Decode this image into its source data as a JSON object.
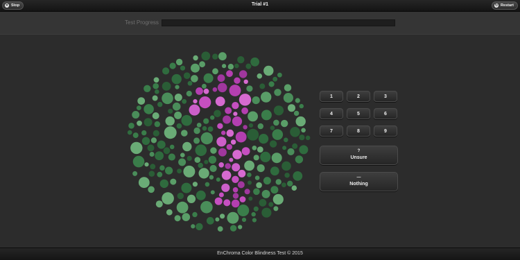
{
  "header": {
    "title": "Trial #1",
    "stop_label": "Stop",
    "restart_label": "Restart"
  },
  "progress": {
    "label": "Test Progress",
    "value": 0
  },
  "plate": {
    "shown_digit": "1",
    "background_colors": [
      "#2f6b3e",
      "#3a7d4a",
      "#4a8d5a",
      "#5a9e68",
      "#2a5d36",
      "#6aab76"
    ],
    "figure_colors": [
      "#b43fb0",
      "#c54fc0",
      "#d66ad0",
      "#a0379e",
      "#cc5fc9"
    ]
  },
  "keypad": {
    "buttons": [
      {
        "label": "1"
      },
      {
        "label": "2"
      },
      {
        "label": "3"
      },
      {
        "label": "4"
      },
      {
        "label": "5"
      },
      {
        "label": "6"
      },
      {
        "label": "7"
      },
      {
        "label": "8"
      },
      {
        "label": "9"
      }
    ],
    "unsure": {
      "symbol": "?",
      "label": "Unsure"
    },
    "nothing": {
      "symbol": "—",
      "label": "Nothing"
    }
  },
  "footer": {
    "text": "EnChroma Color Blindness Test © 2015"
  }
}
